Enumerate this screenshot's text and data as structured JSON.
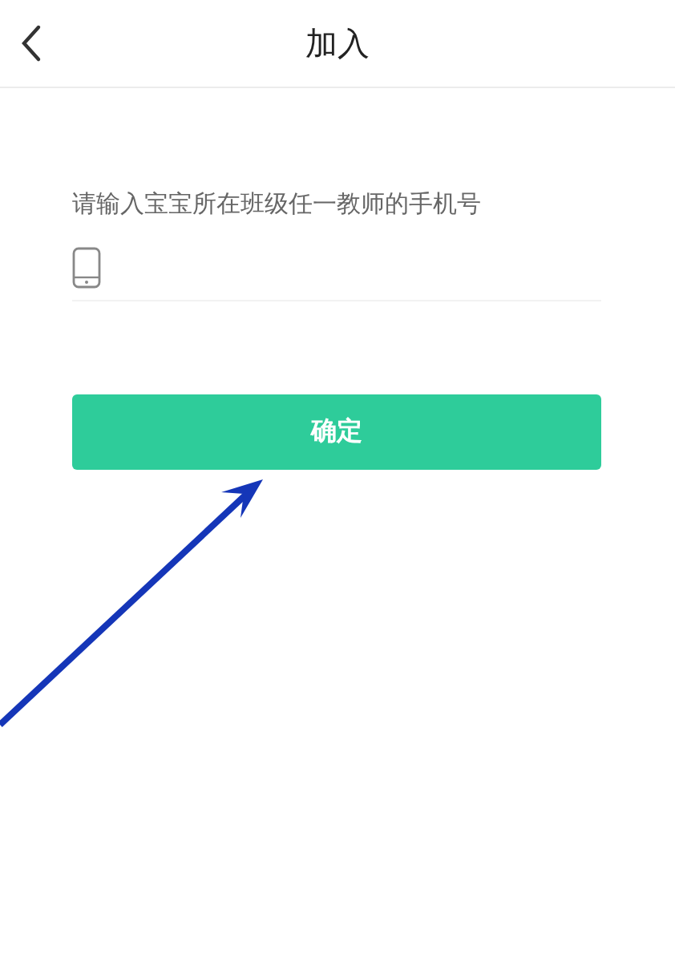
{
  "header": {
    "title": "加入"
  },
  "form": {
    "prompt": "请输入宝宝所在班级任一教师的手机号",
    "confirm_label": "确定"
  },
  "annotation": {
    "kind": "arrow"
  }
}
